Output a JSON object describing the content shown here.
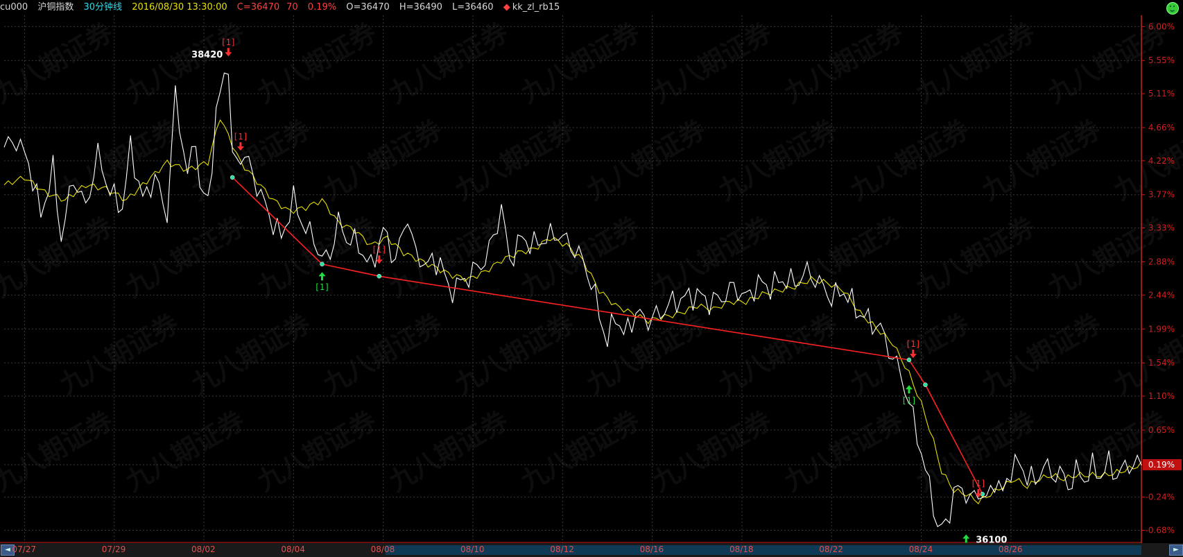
{
  "header": {
    "symbol": "cu000",
    "name": "沪铜指数",
    "period": "30分钟线",
    "datetime": "2016/08/30 13:30:00",
    "close": "C=36470",
    "change": "70",
    "change_pct": "0.19%",
    "open": "O=36470",
    "high": "H=36490",
    "low": "L=36460",
    "indicator": "kk_zl_rb15"
  },
  "watermark_text": "九八期证券",
  "colors": {
    "price_line": "#ffffff",
    "avg_line": "#e8e000",
    "trend_line": "#ff2020",
    "axis": "#d02020",
    "grid": "#3a3a3a",
    "up_marker": "#20e040",
    "down_marker": "#ff3030"
  },
  "chart_data": {
    "type": "line",
    "ylim": [
      -0.85,
      6.15
    ],
    "yticks": [
      "6.00%",
      "5.55%",
      "5.11%",
      "4.66%",
      "4.22%",
      "3.77%",
      "3.33%",
      "2.88%",
      "2.44%",
      "1.99%",
      "1.54%",
      "1.10%",
      "0.65%",
      "0.19%",
      "-0.24%",
      "-0.68%"
    ],
    "ytick_values": [
      6.0,
      5.55,
      5.11,
      4.66,
      4.22,
      3.77,
      3.33,
      2.88,
      2.44,
      1.99,
      1.54,
      1.1,
      0.65,
      0.19,
      -0.24,
      -0.68
    ],
    "current_label": "0.19%",
    "x_count": 280,
    "xticks": [
      {
        "label": "07/27",
        "i": 5
      },
      {
        "label": "07/29",
        "i": 27
      },
      {
        "label": "08/02",
        "i": 49
      },
      {
        "label": "08/04",
        "i": 71
      },
      {
        "label": "08/08",
        "i": 93
      },
      {
        "label": "08/10",
        "i": 115
      },
      {
        "label": "08/12",
        "i": 137
      },
      {
        "label": "08/16",
        "i": 159
      },
      {
        "label": "08/18",
        "i": 181
      },
      {
        "label": "08/22",
        "i": 203
      },
      {
        "label": "08/24",
        "i": 225
      },
      {
        "label": "08/26",
        "i": 247
      }
    ],
    "price_series_name": "",
    "price_anchors": [
      [
        0,
        4.4
      ],
      [
        3,
        4.5
      ],
      [
        6,
        4.2
      ],
      [
        9,
        3.5
      ],
      [
        12,
        4.1
      ],
      [
        14,
        3.2
      ],
      [
        17,
        4.0
      ],
      [
        20,
        3.6
      ],
      [
        23,
        4.3
      ],
      [
        26,
        3.8
      ],
      [
        29,
        3.6
      ],
      [
        31,
        4.4
      ],
      [
        34,
        3.7
      ],
      [
        37,
        4.0
      ],
      [
        40,
        3.5
      ],
      [
        42,
        5.1
      ],
      [
        45,
        4.0
      ],
      [
        47,
        4.6
      ],
      [
        48,
        3.8
      ],
      [
        50,
        3.7
      ],
      [
        52,
        4.8
      ],
      [
        54,
        5.4
      ],
      [
        55,
        5.5
      ],
      [
        56,
        4.2
      ],
      [
        59,
        4.3
      ],
      [
        62,
        3.9
      ],
      [
        65,
        3.5
      ],
      [
        68,
        3.2
      ],
      [
        71,
        3.7
      ],
      [
        74,
        3.3
      ],
      [
        76,
        3.2
      ],
      [
        78,
        2.9
      ],
      [
        80,
        3.0
      ],
      [
        82,
        3.4
      ],
      [
        84,
        3.2
      ],
      [
        87,
        3.1
      ],
      [
        90,
        2.8
      ],
      [
        93,
        3.3
      ],
      [
        96,
        2.9
      ],
      [
        99,
        3.5
      ],
      [
        101,
        2.95
      ],
      [
        104,
        2.85
      ],
      [
        107,
        2.9
      ],
      [
        109,
        2.5
      ],
      [
        112,
        2.6
      ],
      [
        115,
        2.75
      ],
      [
        118,
        2.9
      ],
      [
        120,
        3.2
      ],
      [
        122,
        3.6
      ],
      [
        124,
        2.9
      ],
      [
        127,
        3.2
      ],
      [
        130,
        3.1
      ],
      [
        133,
        3.2
      ],
      [
        136,
        3.25
      ],
      [
        139,
        3.1
      ],
      [
        142,
        2.9
      ],
      [
        144,
        2.6
      ],
      [
        146,
        2.2
      ],
      [
        148,
        1.8
      ],
      [
        150,
        2.2
      ],
      [
        152,
        1.9
      ],
      [
        155,
        2.2
      ],
      [
        158,
        2.1
      ],
      [
        161,
        2.2
      ],
      [
        164,
        2.35
      ],
      [
        167,
        2.4
      ],
      [
        170,
        2.45
      ],
      [
        173,
        2.35
      ],
      [
        176,
        2.4
      ],
      [
        179,
        2.55
      ],
      [
        182,
        2.4
      ],
      [
        185,
        2.6
      ],
      [
        188,
        2.55
      ],
      [
        191,
        2.65
      ],
      [
        194,
        2.6
      ],
      [
        197,
        2.75
      ],
      [
        200,
        2.6
      ],
      [
        203,
        2.4
      ],
      [
        206,
        2.5
      ],
      [
        209,
        2.25
      ],
      [
        212,
        2.1
      ],
      [
        215,
        2.0
      ],
      [
        218,
        1.6
      ],
      [
        220,
        1.4
      ],
      [
        222,
        1.0
      ],
      [
        224,
        0.6
      ],
      [
        226,
        0.1
      ],
      [
        228,
        -0.3
      ],
      [
        229,
        -0.68
      ],
      [
        231,
        -0.6
      ],
      [
        233,
        -0.2
      ],
      [
        235,
        -0.1
      ],
      [
        237,
        -0.3
      ],
      [
        239,
        -0.15
      ],
      [
        241,
        -0.3
      ],
      [
        243,
        0.0
      ],
      [
        245,
        -0.2
      ],
      [
        247,
        0.15
      ],
      [
        249,
        0.2
      ],
      [
        251,
        0.05
      ],
      [
        253,
        -0.05
      ],
      [
        255,
        0.2
      ],
      [
        257,
        0.05
      ],
      [
        259,
        0.1
      ],
      [
        261,
        -0.1
      ],
      [
        263,
        0.1
      ],
      [
        265,
        0.0
      ],
      [
        267,
        0.15
      ],
      [
        269,
        0.05
      ],
      [
        271,
        0.2
      ],
      [
        273,
        0.05
      ],
      [
        276,
        0.2
      ],
      [
        279,
        0.19
      ]
    ],
    "avg_anchors": [
      [
        0,
        3.9
      ],
      [
        5,
        4.0
      ],
      [
        10,
        3.8
      ],
      [
        15,
        3.7
      ],
      [
        20,
        3.9
      ],
      [
        25,
        3.85
      ],
      [
        30,
        3.7
      ],
      [
        35,
        3.95
      ],
      [
        40,
        4.2
      ],
      [
        45,
        4.1
      ],
      [
        50,
        4.2
      ],
      [
        53,
        4.8
      ],
      [
        55,
        4.55
      ],
      [
        58,
        4.2
      ],
      [
        62,
        3.95
      ],
      [
        66,
        3.7
      ],
      [
        70,
        3.55
      ],
      [
        74,
        3.6
      ],
      [
        78,
        3.7
      ],
      [
        82,
        3.4
      ],
      [
        86,
        3.3
      ],
      [
        90,
        3.1
      ],
      [
        94,
        3.2
      ],
      [
        98,
        3.0
      ],
      [
        102,
        2.9
      ],
      [
        106,
        2.8
      ],
      [
        110,
        2.7
      ],
      [
        114,
        2.65
      ],
      [
        118,
        2.75
      ],
      [
        122,
        2.9
      ],
      [
        126,
        3.0
      ],
      [
        130,
        3.05
      ],
      [
        134,
        3.2
      ],
      [
        138,
        3.1
      ],
      [
        142,
        2.9
      ],
      [
        146,
        2.5
      ],
      [
        150,
        2.3
      ],
      [
        154,
        2.2
      ],
      [
        158,
        2.1
      ],
      [
        162,
        2.15
      ],
      [
        166,
        2.2
      ],
      [
        170,
        2.3
      ],
      [
        174,
        2.25
      ],
      [
        178,
        2.35
      ],
      [
        182,
        2.35
      ],
      [
        186,
        2.45
      ],
      [
        190,
        2.5
      ],
      [
        194,
        2.55
      ],
      [
        198,
        2.65
      ],
      [
        202,
        2.6
      ],
      [
        206,
        2.5
      ],
      [
        210,
        2.2
      ],
      [
        214,
        2.0
      ],
      [
        218,
        1.8
      ],
      [
        222,
        1.4
      ],
      [
        225,
        1.0
      ],
      [
        228,
        0.5
      ],
      [
        230,
        0.1
      ],
      [
        233,
        -0.15
      ],
      [
        236,
        -0.2
      ],
      [
        239,
        -0.3
      ],
      [
        242,
        -0.2
      ],
      [
        245,
        -0.1
      ],
      [
        248,
        0.0
      ],
      [
        251,
        -0.1
      ],
      [
        254,
        0.0
      ],
      [
        257,
        0.05
      ],
      [
        260,
        0.0
      ],
      [
        263,
        0.05
      ],
      [
        266,
        0.05
      ],
      [
        270,
        0.05
      ],
      [
        274,
        0.1
      ],
      [
        279,
        0.19
      ]
    ],
    "trend_line": [
      [
        56,
        4.0
      ],
      [
        78,
        2.85
      ],
      [
        92,
        2.69
      ],
      [
        222,
        1.58
      ],
      [
        226,
        1.25
      ],
      [
        240,
        -0.2
      ]
    ],
    "signals": [
      {
        "i": 55,
        "y": 5.55,
        "dir": "down",
        "label": "[1]",
        "value": "38420"
      },
      {
        "i": 58,
        "y": 4.3,
        "dir": "down",
        "label": "[1]"
      },
      {
        "i": 78,
        "y": 2.8,
        "dir": "up",
        "label": "[1]"
      },
      {
        "i": 92,
        "y": 2.8,
        "dir": "down",
        "label": "[1]"
      },
      {
        "i": 223,
        "y": 1.55,
        "dir": "down",
        "label": "[1]"
      },
      {
        "i": 222,
        "y": 1.3,
        "dir": "up",
        "label": "[1]"
      },
      {
        "i": 239,
        "y": -0.3,
        "dir": "down",
        "label": "[1]"
      },
      {
        "i": 236,
        "y": -0.68,
        "dir": "up",
        "label": "[1]",
        "value": "36100"
      }
    ],
    "xlabel": "",
    "ylabel": ""
  },
  "scrollbar": {
    "left_arrow": "◄",
    "right_arrow": "►"
  }
}
